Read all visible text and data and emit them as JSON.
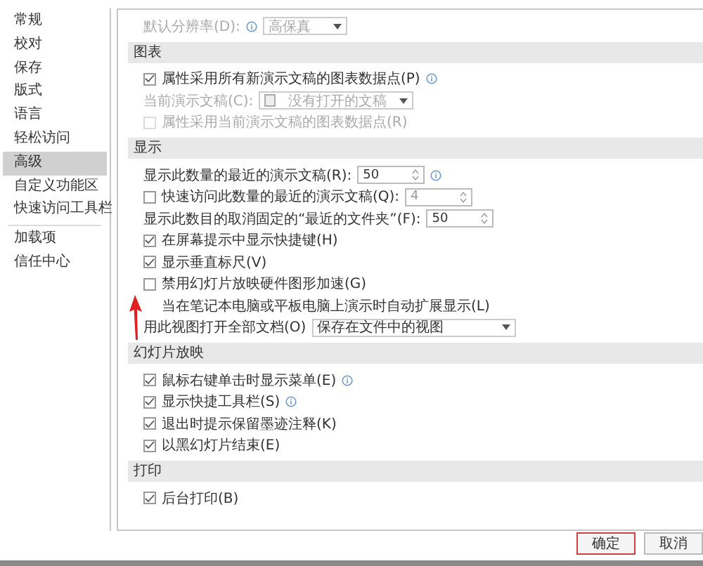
{
  "sidebar": {
    "items": [
      {
        "label": "常规",
        "selected": false
      },
      {
        "label": "校对",
        "selected": false
      },
      {
        "label": "保存",
        "selected": false
      },
      {
        "label": "版式",
        "selected": false
      },
      {
        "label": "语言",
        "selected": false
      },
      {
        "label": "轻松访问",
        "selected": false
      },
      {
        "label": "高级",
        "selected": true
      },
      {
        "label": "自定义功能区",
        "selected": false
      },
      {
        "label": "快速访问工具栏",
        "selected": false
      },
      {
        "label": "加载项",
        "selected": false,
        "divider_before": true
      },
      {
        "label": "信任中心",
        "selected": false
      }
    ]
  },
  "top_row": {
    "kind": "select",
    "label": "默认分辨率(D):",
    "value": "高保真",
    "info": true,
    "disabled": true
  },
  "sections": [
    {
      "title": "图表",
      "rows": [
        {
          "kind": "check",
          "label": "属性采用所有新演示文稿的图表数据点(P)",
          "checked": true,
          "info": true,
          "disabled": false
        },
        {
          "kind": "select",
          "label": "当前演示文稿(C):",
          "value": "没有打开的文稿",
          "doc_icon": true,
          "disabled": true
        },
        {
          "kind": "check",
          "label": "属性采用当前演示文稿的图表数据点(R)",
          "checked": false,
          "disabled": true
        }
      ]
    },
    {
      "title": "显示",
      "rows": [
        {
          "kind": "spin",
          "label": "显示此数量的最近的演示文稿(R):",
          "value": "50",
          "info": true,
          "disabled": false
        },
        {
          "kind": "checkspin",
          "label": "快速访问此数量的最近的演示文稿(Q):",
          "checked": false,
          "value": "4",
          "disabled": false
        },
        {
          "kind": "spin",
          "label": "显示此数目的取消固定的“最近的文件夹”(F):",
          "value": "50",
          "disabled": false
        },
        {
          "kind": "check",
          "label": "在屏幕提示中显示快捷键(H)",
          "checked": true,
          "disabled": false
        },
        {
          "kind": "check",
          "label": "显示垂直标尺(V)",
          "checked": true,
          "disabled": false
        },
        {
          "kind": "check",
          "label": "禁用幻灯片放映硬件图形加速(G)",
          "checked": false,
          "disabled": false
        },
        {
          "kind": "covered",
          "label": "当在笔记本电脑或平板电脑上演示时自动扩展显示(L)",
          "disabled": false
        },
        {
          "kind": "wideselect",
          "label": "用此视图打开全部文档(O)",
          "value": "保存在文件中的视图",
          "disabled": false
        }
      ]
    },
    {
      "title": "幻灯片放映",
      "rows": [
        {
          "kind": "check",
          "label": "鼠标右键单击时显示菜单(E)",
          "checked": true,
          "info": true,
          "disabled": false
        },
        {
          "kind": "check",
          "label": "显示快捷工具栏(S)",
          "checked": true,
          "info": true,
          "disabled": false
        },
        {
          "kind": "check",
          "label": "退出时提示保留墨迹注释(K)",
          "checked": true,
          "disabled": false
        },
        {
          "kind": "check",
          "label": "以黑幻灯片结束(E)",
          "checked": true,
          "disabled": false
        }
      ]
    },
    {
      "title": "打印",
      "rows": [
        {
          "kind": "check",
          "label": "后台打印(B)",
          "checked": true,
          "disabled": false
        }
      ]
    }
  ],
  "buttons": [
    {
      "label": "确定",
      "highlighted": true
    },
    {
      "label": "取消",
      "highlighted": false
    }
  ]
}
